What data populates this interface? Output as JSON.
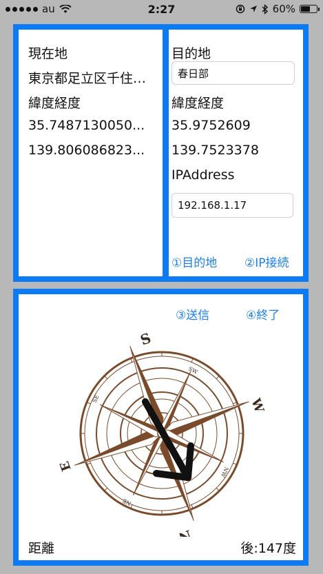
{
  "status_bar": {
    "carrier": "au",
    "time": "2:27",
    "battery": "60%",
    "battery_level": 0.6
  },
  "current_location": {
    "title": "現在地",
    "address": "東京都足立区千住…",
    "coords_label": "緯度経度",
    "latitude": "35.7487130050...",
    "longitude": "139.806086823..."
  },
  "destination": {
    "title": "目的地",
    "input_value": "春日部",
    "coords_label": "緯度経度",
    "latitude": "35.9752609",
    "longitude": "139.7523378",
    "ip_label": "IPAddress",
    "ip_value": "192.168.1.17",
    "button_destination": "①目的地",
    "button_ip_connect": "②IP接続"
  },
  "compass_panel": {
    "button_send": "③送信",
    "button_end": "④終了",
    "distance_label": "距離",
    "direction_text": "後:147度",
    "compass_letters": {
      "top": "S",
      "bottom": "N",
      "left": "E",
      "right": "W",
      "sw": "SW",
      "se": "SE",
      "nw": "NW",
      "ne": "NE"
    },
    "arrow_color": "#111111",
    "rose_color": "#7a4a2a"
  },
  "colors": {
    "accent": "#0c7bf4",
    "link": "#1a7ff0",
    "background": "#b8b8b8"
  }
}
